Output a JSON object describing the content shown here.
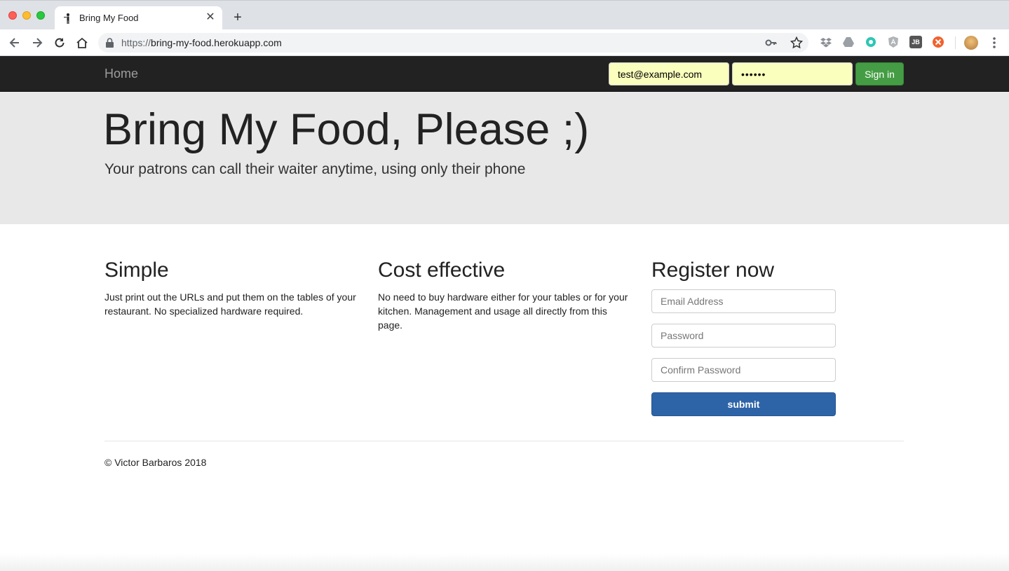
{
  "browser": {
    "tab_title": "Bring My Food",
    "url_scheme": "https://",
    "url_host": "bring-my-food.herokuapp.com",
    "new_tab_symbol": "+",
    "close_symbol": "✕"
  },
  "navbar": {
    "brand": "Home",
    "email_value": "test@example.com",
    "password_value": "••••••",
    "signin_label": "Sign in",
    "signin_color": "#449d44"
  },
  "hero": {
    "title": "Bring My Food, Please ;)",
    "subtitle": "Your patrons can call their waiter anytime, using only their phone"
  },
  "features": [
    {
      "heading": "Simple",
      "text": "Just print out the URLs and put them on the tables of your restaurant. No specialized hardware required."
    },
    {
      "heading": "Cost effective",
      "text": "No need to buy hardware either for your tables or for your kitchen. Management and usage all directly from this page."
    }
  ],
  "register": {
    "heading": "Register now",
    "email_placeholder": "Email Address",
    "password_placeholder": "Password",
    "confirm_placeholder": "Confirm Password",
    "submit_label": "submit",
    "submit_color": "#2d64a8"
  },
  "footer": {
    "copyright": "© Victor Barbaros 2018"
  },
  "icons": {
    "back": "back-arrow-icon",
    "forward": "forward-arrow-icon",
    "reload": "reload-icon",
    "home": "home-icon",
    "lock": "lock-icon",
    "key": "key-icon",
    "star": "bookmark-star-icon",
    "menu": "kebab-menu-icon"
  }
}
